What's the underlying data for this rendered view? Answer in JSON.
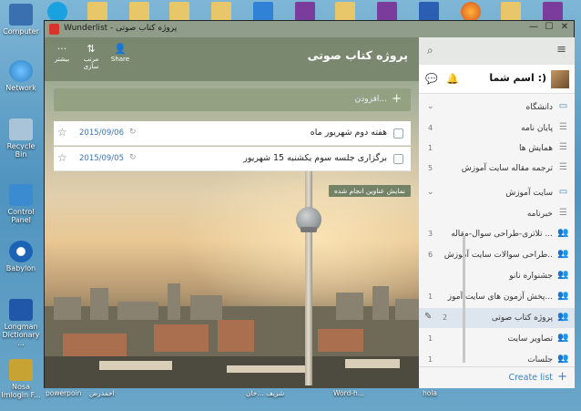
{
  "desktop": {
    "icons": [
      {
        "label": "Computer",
        "color": "#3a6fb0"
      },
      {
        "label": "Network",
        "color": "#2d7fc1"
      },
      {
        "label": "Recycle Bin",
        "color": "#7fa6c2"
      },
      {
        "label": "Control Panel",
        "color": "#3b8bd0"
      },
      {
        "label": "Babylon",
        "color": "#1d63b5"
      },
      {
        "label": "Longman Dictionary ...",
        "color": "#2157a8"
      },
      {
        "label": "Nosa Imlogin F...",
        "color": "#c6a332"
      }
    ],
    "taskbar_labels": [
      "powerpoin",
      "احمدرض",
      "شریف ...خان",
      "Word-h...",
      "hola"
    ]
  },
  "window": {
    "title": "Wunderlist - پروژه کتاب صوتی",
    "controls": {
      "minimize": "—",
      "maximize": "☐",
      "close": "✕"
    }
  },
  "toolbar": {
    "more_label": "بیشتر",
    "more_icon": "···",
    "sort_label": "مرتب سازی",
    "sort_icon": "⇅",
    "share_label": "Share",
    "share_icon": "👤"
  },
  "list_title": "پروژه کتاب صوتی",
  "add_task": {
    "placeholder": "افزودن...",
    "plus": "+"
  },
  "tasks": [
    {
      "title": "هفته دوم شهریور ماه",
      "date": "2015/09/06",
      "repeat_icon": "↻",
      "star": "☆"
    },
    {
      "title": "برگزاری جلسه سوم یکشنبه 15 شهریور",
      "date": "2015/09/05",
      "repeat_icon": "↻",
      "star": "☆"
    }
  ],
  "show_completed": "نمایش عناوین انجام شده",
  "sidebar": {
    "search_icon": "⌕",
    "menu_icon": "≡",
    "user": {
      "name": "اسم شما :)",
      "bell": "🔔",
      "chat": "💬"
    },
    "items": [
      {
        "type": "folder",
        "label": "دانشگاه",
        "icon": "▭",
        "count": "",
        "chev": "⌄"
      },
      {
        "type": "list",
        "label": "پایان نامه",
        "icon": "☰",
        "count": "4"
      },
      {
        "type": "list",
        "label": "همایش ها",
        "icon": "☰",
        "count": "1"
      },
      {
        "type": "list",
        "label": "ترجمه مقاله سایت آموزش",
        "icon": "☰",
        "count": "5"
      },
      {
        "type": "folder",
        "label": "سایت آموزش",
        "icon": "▭",
        "count": "",
        "chev": "⌄"
      },
      {
        "type": "list",
        "label": "خبرنامه",
        "icon": "☰",
        "count": ""
      },
      {
        "type": "list",
        "label": "تلاتری-طراحی سوال-مقاله ...",
        "icon": "👥",
        "count": "3"
      },
      {
        "type": "list",
        "label": "طراحی سوالات سایت آموزش..",
        "icon": "👥",
        "count": "6"
      },
      {
        "type": "list",
        "label": "جشنواره نانو",
        "icon": "👥",
        "count": ""
      },
      {
        "type": "list",
        "label": "پخش آزمون های سایت آموز...",
        "icon": "👥",
        "count": "1"
      },
      {
        "type": "list",
        "label": "پروژه کتاب صوتی",
        "icon": "👥",
        "count": "2",
        "active": true,
        "pencil": "✎"
      },
      {
        "type": "list",
        "label": "تصاویر سایت",
        "icon": "👥",
        "count": "1"
      },
      {
        "type": "list",
        "label": "جلسات",
        "icon": "👥",
        "count": "1"
      }
    ],
    "create_list": {
      "label": "Create list",
      "plus": "+"
    }
  }
}
